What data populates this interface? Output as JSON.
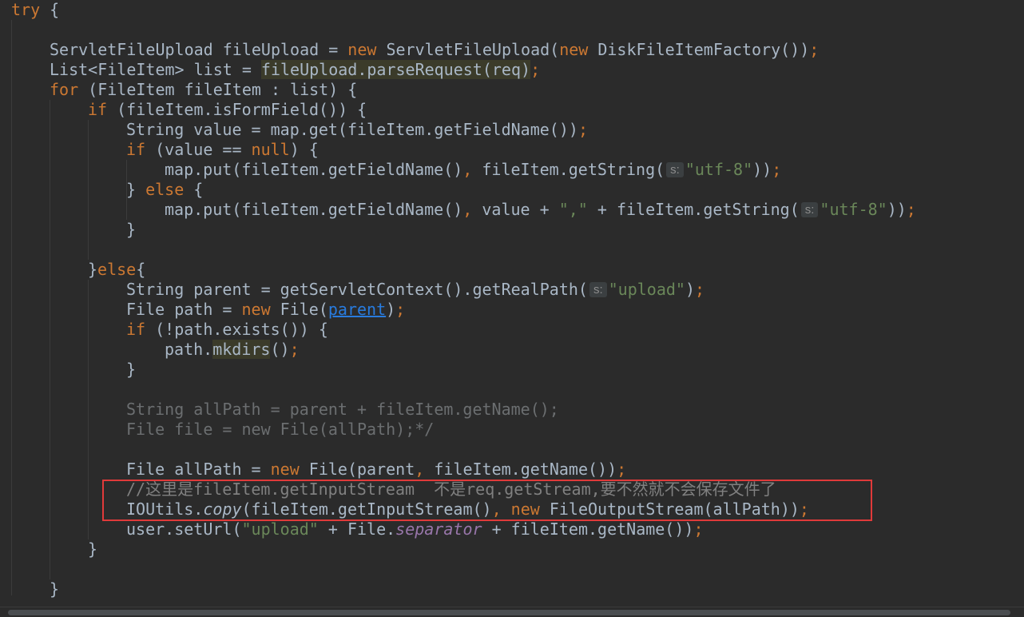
{
  "editor": {
    "colors": {
      "background": "#2b2b2b",
      "default_text": "#a9b7c6",
      "keyword": "#cc7832",
      "string": "#6a8759",
      "comment": "#808080",
      "static_field": "#9876aa",
      "link": "#287bde",
      "highlight_box": "#e03a3a"
    },
    "lines": [
      {
        "indent": 0,
        "tokens": [
          {
            "t": "try",
            "c": "kw"
          },
          {
            "t": " {"
          }
        ]
      },
      {
        "indent": 0,
        "tokens": []
      },
      {
        "indent": 1,
        "tokens": [
          {
            "t": "ServletFileUpload fileUpload = "
          },
          {
            "t": "new",
            "c": "kw"
          },
          {
            "t": " ServletFileUpload("
          },
          {
            "t": "new",
            "c": "kw"
          },
          {
            "t": " DiskFileItemFactory())"
          },
          {
            "t": ";",
            "c": "kw"
          }
        ]
      },
      {
        "indent": 1,
        "tokens": [
          {
            "t": "List<FileItem> list = "
          },
          {
            "t": "fileUpload.parseRequest(req)",
            "c": "warn"
          },
          {
            "t": ";",
            "c": "kw"
          }
        ]
      },
      {
        "indent": 1,
        "tokens": [
          {
            "t": "for",
            "c": "kw"
          },
          {
            "t": " (FileItem fileItem : list) {"
          }
        ]
      },
      {
        "indent": 2,
        "tokens": [
          {
            "t": "if",
            "c": "kw"
          },
          {
            "t": " (fileItem.isFormField()) {"
          }
        ]
      },
      {
        "indent": 3,
        "tokens": [
          {
            "t": "String value = map.get(fileItem.getFieldName())"
          },
          {
            "t": ";",
            "c": "kw"
          }
        ]
      },
      {
        "indent": 3,
        "tokens": [
          {
            "t": "if",
            "c": "kw"
          },
          {
            "t": " (value == "
          },
          {
            "t": "null",
            "c": "kw"
          },
          {
            "t": ") {"
          }
        ]
      },
      {
        "indent": 4,
        "tokens": [
          {
            "t": "map.put(fileItem.getFieldName()"
          },
          {
            "t": ",",
            "c": "kw"
          },
          {
            "t": " fileItem.getString("
          },
          {
            "t": "s:",
            "c": "hint"
          },
          {
            "t": "\"utf-8\"",
            "c": "str"
          },
          {
            "t": "))"
          },
          {
            "t": ";",
            "c": "kw"
          }
        ]
      },
      {
        "indent": 3,
        "tokens": [
          {
            "t": "} "
          },
          {
            "t": "else",
            "c": "kw"
          },
          {
            "t": " {"
          }
        ]
      },
      {
        "indent": 4,
        "tokens": [
          {
            "t": "map.put(fileItem.getFieldName()"
          },
          {
            "t": ",",
            "c": "kw"
          },
          {
            "t": " value + "
          },
          {
            "t": "\",\"",
            "c": "str"
          },
          {
            "t": " + fileItem.getString("
          },
          {
            "t": "s:",
            "c": "hint"
          },
          {
            "t": "\"utf-8\"",
            "c": "str"
          },
          {
            "t": "))"
          },
          {
            "t": ";",
            "c": "kw"
          }
        ]
      },
      {
        "indent": 3,
        "tokens": [
          {
            "t": "}"
          }
        ]
      },
      {
        "indent": 0,
        "tokens": []
      },
      {
        "indent": 2,
        "tokens": [
          {
            "t": "}"
          },
          {
            "t": "else",
            "c": "kw"
          },
          {
            "t": "{"
          }
        ]
      },
      {
        "indent": 3,
        "tokens": [
          {
            "t": "String parent = getServletContext().getRealPath("
          },
          {
            "t": "s:",
            "c": "hint"
          },
          {
            "t": "\"upload\"",
            "c": "str"
          },
          {
            "t": ")"
          },
          {
            "t": ";",
            "c": "kw"
          }
        ]
      },
      {
        "indent": 3,
        "tokens": [
          {
            "t": "File path = "
          },
          {
            "t": "new",
            "c": "kw"
          },
          {
            "t": " File("
          },
          {
            "t": "parent",
            "c": "link"
          },
          {
            "t": ")"
          },
          {
            "t": ";",
            "c": "kw"
          }
        ]
      },
      {
        "indent": 3,
        "tokens": [
          {
            "t": "if",
            "c": "kw"
          },
          {
            "t": " (!path.exists()) {"
          }
        ]
      },
      {
        "indent": 4,
        "tokens": [
          {
            "t": "path."
          },
          {
            "t": "mkdirs",
            "c": "warn"
          },
          {
            "t": "()"
          },
          {
            "t": ";",
            "c": "kw"
          }
        ]
      },
      {
        "indent": 3,
        "tokens": [
          {
            "t": "}"
          }
        ]
      },
      {
        "indent": 0,
        "tokens": []
      },
      {
        "indent": 3,
        "tokens": [
          {
            "t": "String allPath = parent + fileItem.getName();",
            "c": "dim"
          }
        ]
      },
      {
        "indent": 3,
        "tokens": [
          {
            "t": "File file = new File(allPath);*/",
            "c": "dim"
          }
        ]
      },
      {
        "indent": 0,
        "tokens": []
      },
      {
        "indent": 3,
        "tokens": [
          {
            "t": "File allPath = "
          },
          {
            "t": "new",
            "c": "kw"
          },
          {
            "t": " File(parent"
          },
          {
            "t": ",",
            "c": "kw"
          },
          {
            "t": " fileItem.getName())"
          },
          {
            "t": ";",
            "c": "kw"
          }
        ]
      },
      {
        "indent": 3,
        "tokens": [
          {
            "t": "//这里是fileItem.getInputStream  不是req.getStream,要不然就不会保存文件了",
            "c": "comment"
          }
        ]
      },
      {
        "indent": 3,
        "tokens": [
          {
            "t": "IOUtils."
          },
          {
            "t": "copy",
            "c": "it"
          },
          {
            "t": "(fileItem.getInputStream()"
          },
          {
            "t": ",",
            "c": "kw"
          },
          {
            "t": " "
          },
          {
            "t": "new",
            "c": "kw"
          },
          {
            "t": " FileOutputStream(allPath))"
          },
          {
            "t": ";",
            "c": "kw"
          }
        ]
      },
      {
        "indent": 3,
        "tokens": [
          {
            "t": "user.setUrl("
          },
          {
            "t": "\"upload\"",
            "c": "str"
          },
          {
            "t": " + File."
          },
          {
            "t": "separator",
            "c": "static-field"
          },
          {
            "t": " + fileItem.getName())"
          },
          {
            "t": ";",
            "c": "kw"
          }
        ]
      },
      {
        "indent": 2,
        "tokens": [
          {
            "t": "}"
          }
        ]
      },
      {
        "indent": 0,
        "tokens": []
      },
      {
        "indent": 1,
        "tokens": [
          {
            "t": "}"
          }
        ]
      }
    ]
  }
}
